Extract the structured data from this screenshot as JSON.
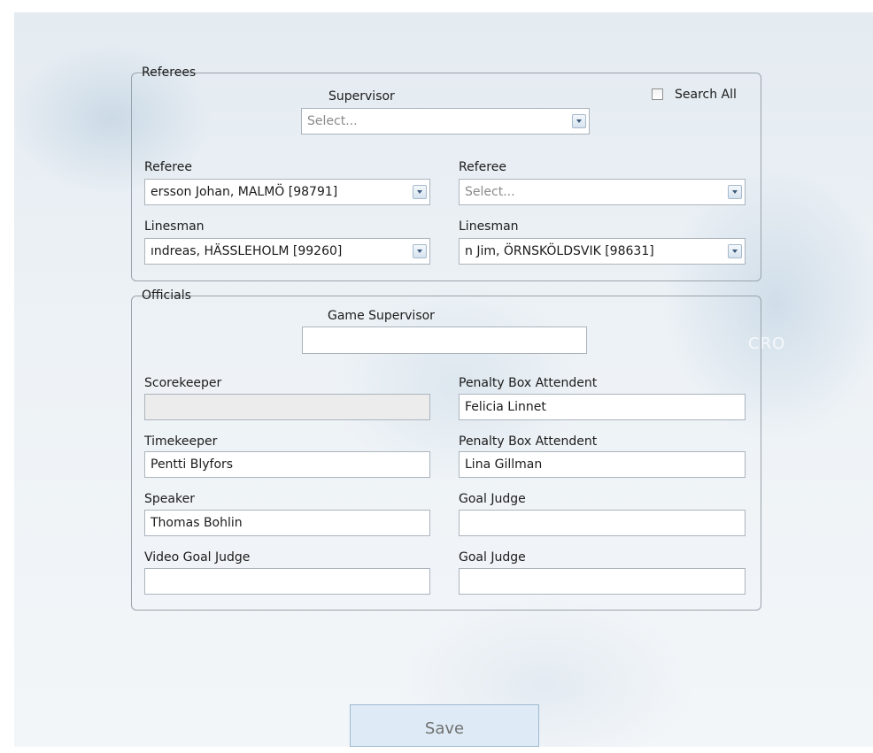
{
  "referees": {
    "legend": "Referees",
    "supervisor_label": "Supervisor",
    "supervisor_value": "Select...",
    "search_all_label": "Search All",
    "search_all_checked": false,
    "referee1_label": "Referee",
    "referee1_value": "ersson Johan, MALMÖ [98791]",
    "referee2_label": "Referee",
    "referee2_value": "Select...",
    "linesman1_label": "Linesman",
    "linesman1_value": "ındreas, HÄSSLEHOLM [99260]",
    "linesman2_label": "Linesman",
    "linesman2_value": "n Jim, ÖRNSKÖLDSVIK [98631]"
  },
  "officials": {
    "legend": "Officials",
    "game_supervisor_label": "Game Supervisor",
    "game_supervisor_value": "",
    "scorekeeper_label": "Scorekeeper",
    "scorekeeper_value": "",
    "penalty_box_1_label": "Penalty Box Attendent",
    "penalty_box_1_value": "Felicia Linnet",
    "timekeeper_label": "Timekeeper",
    "timekeeper_value": "Pentti Blyfors",
    "penalty_box_2_label": "Penalty Box Attendent",
    "penalty_box_2_value": "Lina Gillman",
    "speaker_label": "Speaker",
    "speaker_value": "Thomas Bohlin",
    "goal_judge_1_label": "Goal Judge",
    "goal_judge_1_value": "",
    "video_goal_judge_label": "Video Goal Judge",
    "video_goal_judge_value": "",
    "goal_judge_2_label": "Goal Judge",
    "goal_judge_2_value": ""
  },
  "actions": {
    "save_label": "Save"
  },
  "background": {
    "watermark_text": "CRO"
  }
}
